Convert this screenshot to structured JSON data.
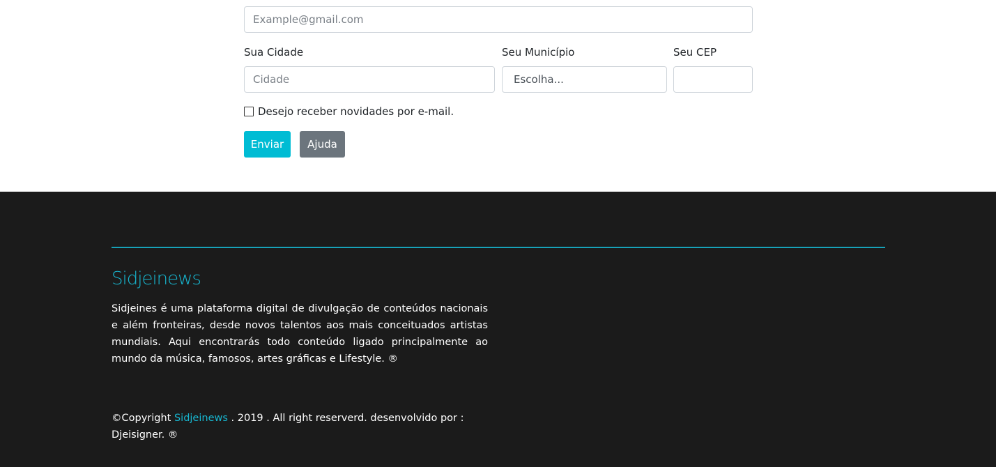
{
  "form": {
    "email_placeholder": "Example@gmail.com",
    "city_label": "Sua Cidade",
    "city_placeholder": "Cidade",
    "municipality_label": "Seu Município",
    "municipality_selected": "Escolha...",
    "cep_label": "Seu CEP",
    "cep_value": "",
    "newsletter_label": "Desejo receber novidades por e-mail.",
    "newsletter_checked": false,
    "send_label": "Enviar",
    "help_label": "Ajuda"
  },
  "footer": {
    "brand": "Sidjeinews",
    "about": "Sidjeines é uma plataforma digital de divulgação de conteúdos nacionais e além fronteiras, desde novos talentos aos mais conceituados artistas mundiais. Aqui encontrarás todo conteúdo ligado principalmente ao mundo da música, famosos, artes gráficas e Lifestyle. ®",
    "copyright_prefix": "©Copyright ",
    "copyright_brand": "Sidjeinews",
    "copyright_suffix": " . 2019 . All right reserverd. desenvolvido por : Djeisigner. ®"
  },
  "colors": {
    "accent": "#17b6d0",
    "send_button": "#00bcd4",
    "help_button": "#6c757d",
    "footer_bg": "#1b1b1b"
  }
}
